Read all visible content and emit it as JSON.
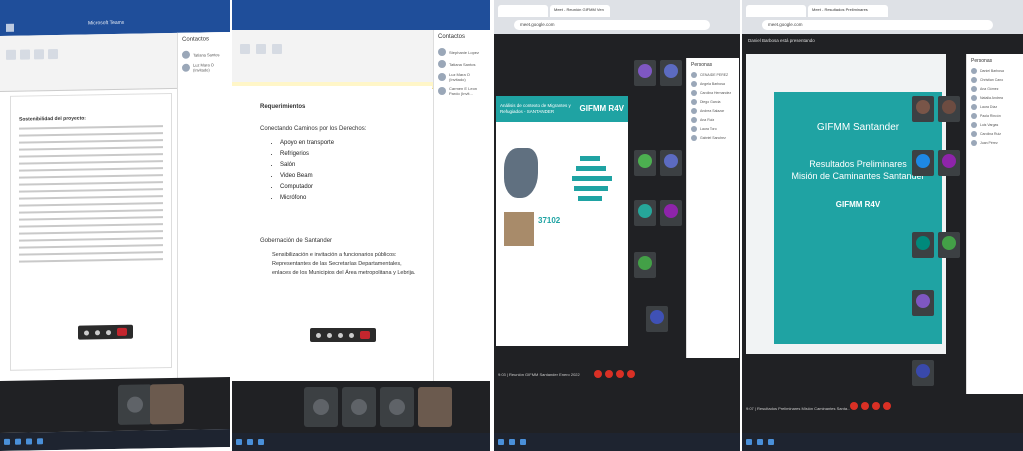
{
  "panel1": {
    "window_title": "Microsoft Teams",
    "doc_heading": "Sostenibilidad del proyecto:",
    "contacts_title": "Contactos",
    "contacts": [
      "Tatiana Santos",
      "Luz Mara O (Invitado)"
    ]
  },
  "panel2": {
    "requirements": "Requerimientos",
    "connect": "Conectando Caminos por los Derechos:",
    "items": [
      "Apoyo en transporte",
      "Refrigerios",
      "Salón",
      "Video Beam",
      "Computador",
      "Micrófono"
    ],
    "gob_heading": "Gobernación de Santander",
    "gob_text": "Sensibilización e invitación a funcionarios públicos: Representantes de las Secretarías Departamentales, enlaces de los Municipios del Área metropolitana y Lebrija.",
    "contacts_title": "Contactos",
    "contacts": [
      "Stephanie Lopez",
      "Tatiana Santos",
      "Luz Mara O (Invitado)",
      "Carmen E Leon Pardo (Invit..."
    ]
  },
  "panel3": {
    "tab": "Meet - Reunión GIFMM Ven",
    "url": "meet.google.com",
    "slide_title": "Análisis de contexto de Migrantes y Refugiados - SANTANDER",
    "logo": "GIFMM R4V",
    "stat": "37102",
    "people_title": "Personas",
    "people": [
      "CENAIDE PEREZ",
      "Angela Barbosa",
      "Carolina Hernandez",
      "Diego Garcia",
      "Andrea Salazar",
      "Ana Ruiz",
      "Laura Toro",
      "Gabriel Sanchez"
    ],
    "footer": "9:03 | Reunión GIFMM Santander Enero 2022"
  },
  "panel4": {
    "tab": "Meet - Resultados Preliminares",
    "url": "meet.google.com",
    "presenter": "Daniel Barbosa está presentando",
    "s1": "GIFMM Santander",
    "s2a": "Resultados Preliminares",
    "s2b": "Misión de Caminantes Santander",
    "s3": "GIFMM R4V",
    "people_title": "Personas",
    "people": [
      "Daniel Barbosa",
      "Christian Cano",
      "Ana Gómez",
      "Natalia Andrea",
      "Laura Díaz",
      "Paola Rincón",
      "Luis Vargas",
      "Carolina Ruiz",
      "Juan Pérez"
    ],
    "footer": "9:07 | Resultados Preliminares Misión Caminantes Santa..."
  }
}
